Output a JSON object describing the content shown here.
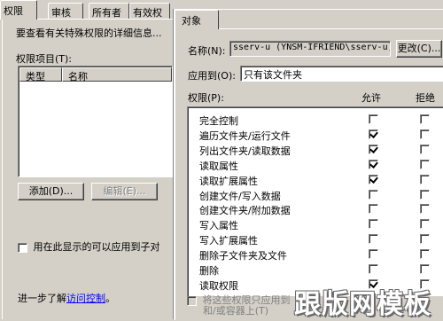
{
  "background_dialog": {
    "tabs": [
      {
        "label": "权限",
        "active": true
      },
      {
        "label": "审核",
        "active": false
      },
      {
        "label": "所有者",
        "active": false
      },
      {
        "label": "有效权",
        "active": false
      }
    ],
    "description": "要查看有关特殊权限的详细信息...",
    "entries_label": "权限项目(T):",
    "columns": [
      "类型",
      "名称"
    ],
    "add_button": "添加(D)...",
    "edit_button": "编辑(E)...",
    "apply_child_label": "用在此显示的可以应用到子对",
    "more_info_prefix": "进一步了解",
    "more_info_link": "访问控制",
    "more_info_suffix": "。"
  },
  "permission_dialog": {
    "tab_label": "对象",
    "name_label": "名称(N):",
    "name_value": "sserv-u (YNSM-IFRIEND\\sserv-u)",
    "change_button": "更改(C)...",
    "apply_to_label": "应用到(O):",
    "apply_to_value": "只有该文件夹",
    "permissions_label": "权限(P):",
    "allow_header": "允许",
    "deny_header": "拒绝",
    "permissions": [
      {
        "name": "完全控制",
        "allow": false,
        "deny": false
      },
      {
        "name": "遍历文件夹/运行文件",
        "allow": true,
        "deny": false
      },
      {
        "name": "列出文件夹/读取数据",
        "allow": true,
        "deny": false
      },
      {
        "name": "读取属性",
        "allow": true,
        "deny": false
      },
      {
        "name": "读取扩展属性",
        "allow": true,
        "deny": false
      },
      {
        "name": "创建文件/写入数据",
        "allow": false,
        "deny": false
      },
      {
        "name": "创建文件夹/附加数据",
        "allow": false,
        "deny": false
      },
      {
        "name": "写入属性",
        "allow": false,
        "deny": false
      },
      {
        "name": "写入扩展属性",
        "allow": false,
        "deny": false
      },
      {
        "name": "删除子文件夹及文件",
        "allow": false,
        "deny": false
      },
      {
        "name": "删除",
        "allow": false,
        "deny": false
      },
      {
        "name": "读取权限",
        "allow": true,
        "deny": false
      }
    ],
    "inherit_line1": "将这些权限只应用到",
    "inherit_line2": "和/或容器上(T)"
  },
  "watermark": "跟版网模板"
}
